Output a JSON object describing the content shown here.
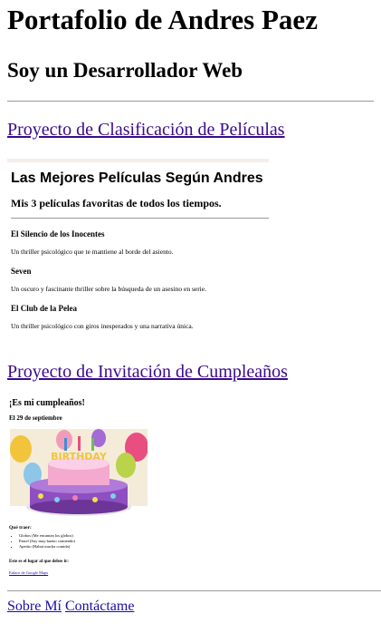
{
  "header": {
    "title": "Portafolio de Andres Paez",
    "subtitle": "Soy un Desarrollador Web"
  },
  "projects": [
    {
      "link_label": "Proyecto de Clasificación de Películas",
      "preview": {
        "title": "Las Mejores Películas Según Andres",
        "subtitle": "Mis 3 películas favoritas de todos los tiempos.",
        "movies": [
          {
            "name": "El Silencio de los Inocentes",
            "description": "Un thriller psicológico que te mantiene al borde del asiento."
          },
          {
            "name": "Seven",
            "description": "Un oscuro y fascinante thriller sobre la búsqueda de un asesino en serie."
          },
          {
            "name": "El Club de la Pelea",
            "description": "Un thriller psicológico con giros inesperados y una narrativa única."
          }
        ]
      }
    },
    {
      "link_label": "Proyecto de Invitación de Cumpleaños",
      "preview": {
        "title": "¡Es mi cumpleaños!",
        "date": "El 29 de septiembre",
        "bring_label": "Qué traer:",
        "bring_items": [
          "Globos (Me encantan los globos)",
          "Pastel (Soy muy bueno comiendo)",
          "Apetito (Habrá mucha comida)"
        ],
        "location_label": "Este es el lugar al que debes ir:",
        "map_link": "Enlace de Google Maps"
      }
    }
  ],
  "footer": {
    "about": "Sobre Mí",
    "contact": "Contáctame"
  },
  "colors": {
    "link_visited": "#3b0a8c",
    "link": "#1a0dab",
    "rule": "#9a9a9a"
  }
}
